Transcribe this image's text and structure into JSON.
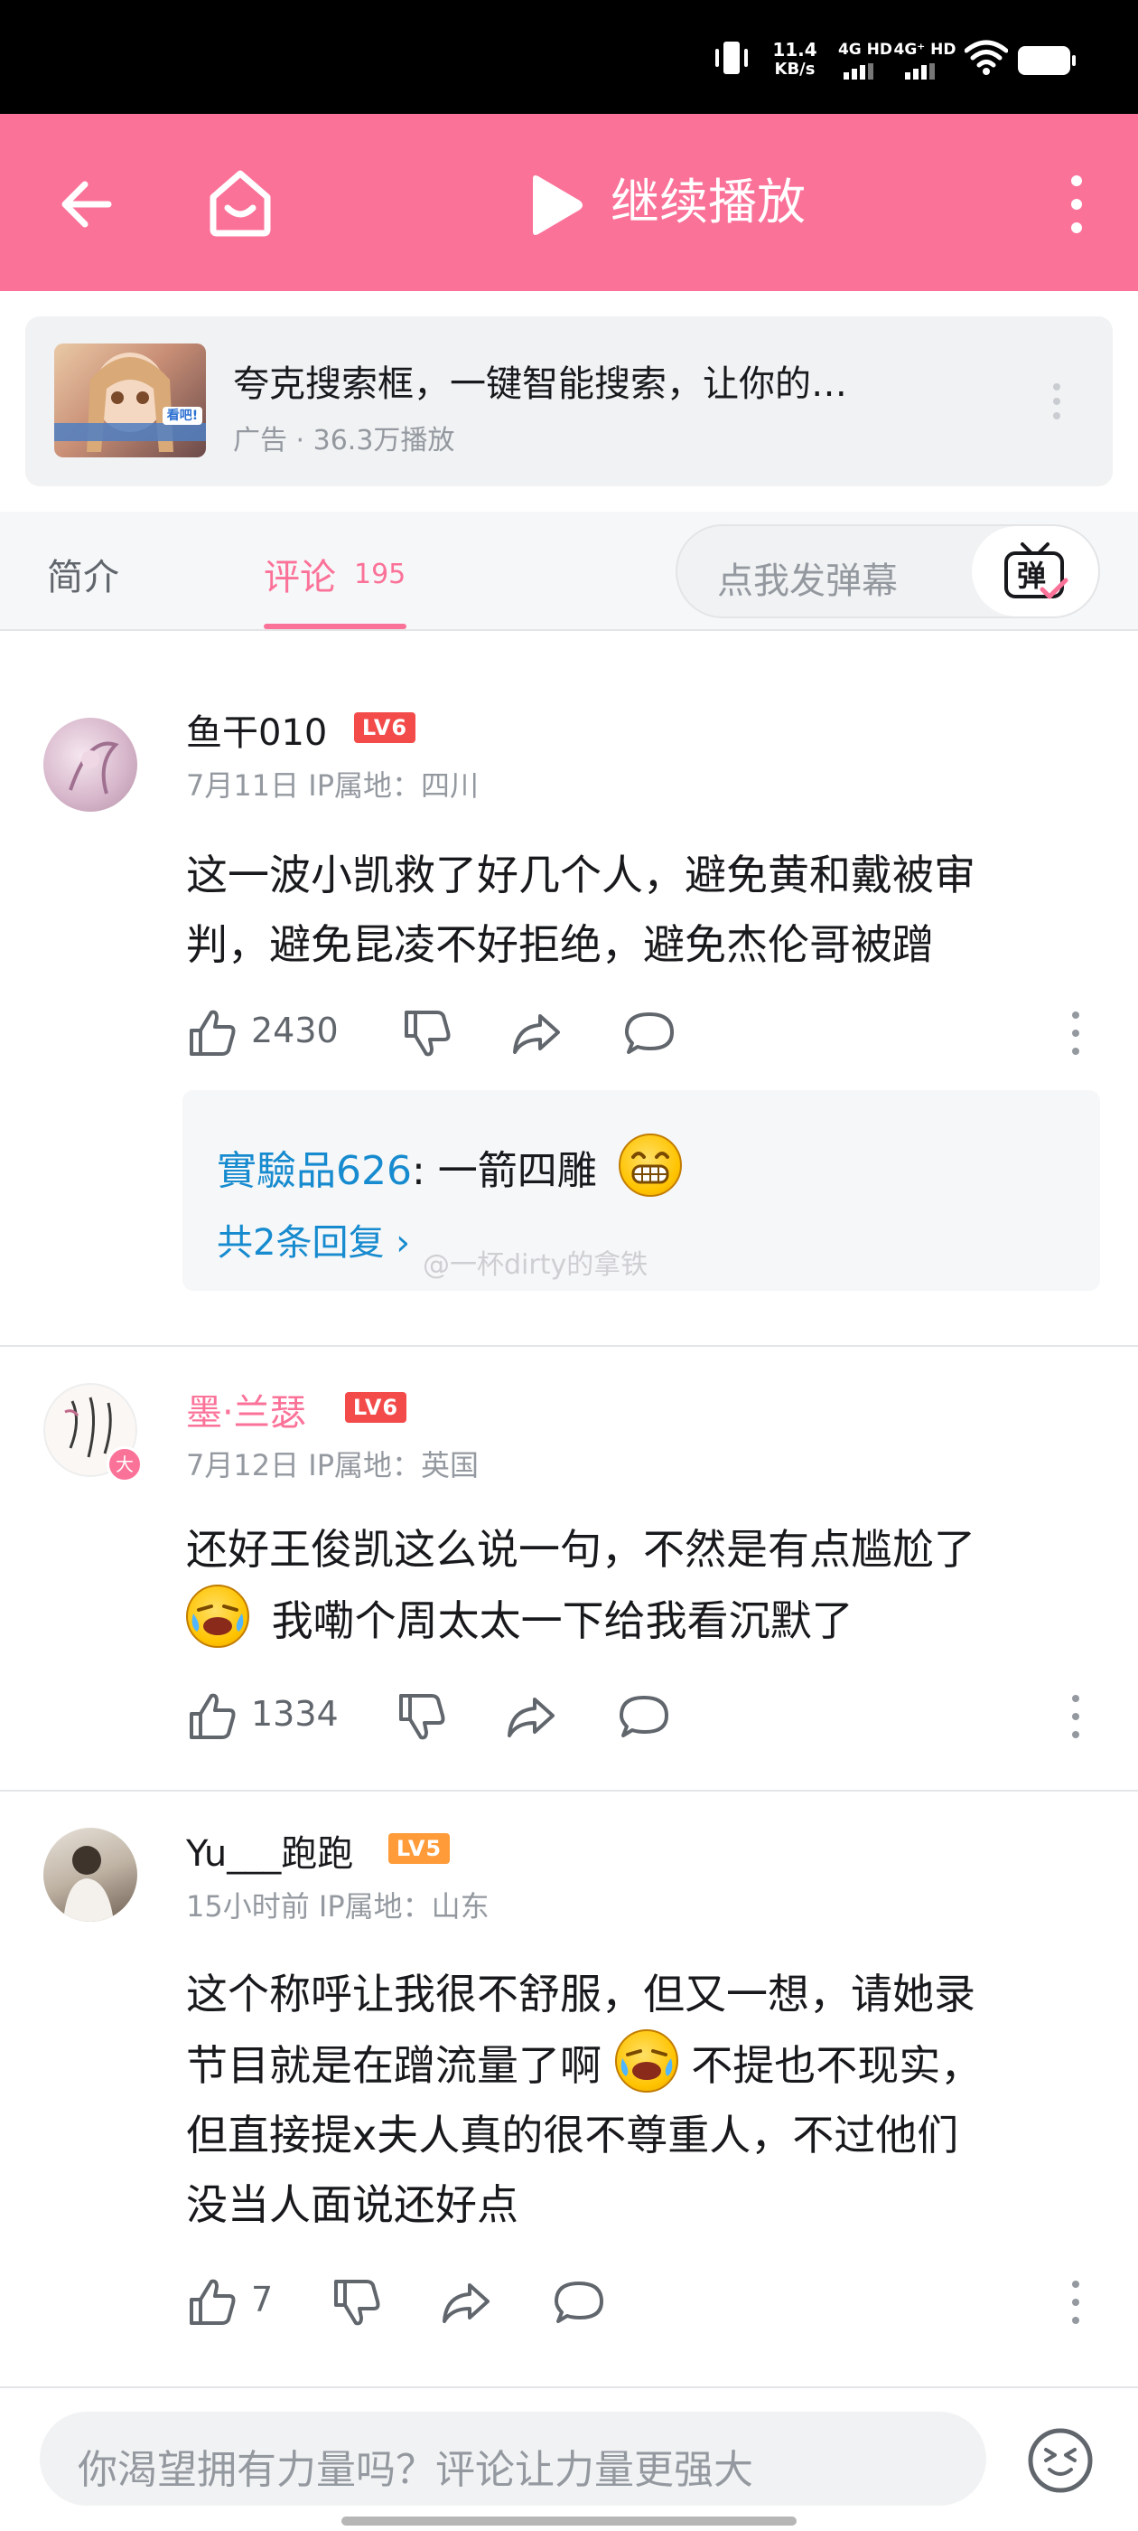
{
  "status_bar": {
    "net_speed_value": "11.4",
    "net_speed_unit": "KB/s",
    "sim1_label": "4G HD",
    "sim2_label": "4G⁺ HD",
    "icons": [
      "vibrate-icon",
      "signal-icon",
      "wifi-icon",
      "battery-icon"
    ]
  },
  "header": {
    "continue_label": "继续播放",
    "accent_color": "#fb7299",
    "icons": [
      "back-arrow-icon",
      "home-icon",
      "play-icon",
      "more-vertical-icon"
    ]
  },
  "ad": {
    "thumb_label": "看吧!",
    "title": "夸克搜索框，一键智能搜索，让你的…",
    "meta": "广告 · 36.3万播放"
  },
  "tabs": {
    "intro": "简介",
    "comments": "评论",
    "comment_count": "195",
    "danmaku_placeholder": "点我发弹幕",
    "danmaku_button": "弹"
  },
  "comments": [
    {
      "username": "鱼干010",
      "level": "LV6",
      "meta": "7月11日 IP属地：四川",
      "lines": [
        "这一波小凯救了好几个人，避免黄和戴被审",
        "判，避免昆凌不好拒绝，避免杰伦哥被蹭"
      ],
      "likes": "2430",
      "reply": {
        "user": "實驗品626",
        "text": ": 一箭四雕",
        "emoji": "grin-emoji",
        "see_all": "共2条回复 ›"
      }
    },
    {
      "username": "墨·兰瑟",
      "level": "LV6",
      "avatar_badge": "大",
      "meta": "7月12日 IP属地：英国",
      "line1": "还好王俊凯这么说一句，不然是有点尴尬了",
      "line2": "我嘞个周太太一下给我看沉默了",
      "likes": "1334"
    },
    {
      "username": "Yu___跑跑",
      "level": "LV5",
      "meta": "15小时前 IP属地：山东",
      "line1": "这个称呼让我很不舒服，但又一想，请她录",
      "line2a": "节目就是在蹭流量了啊",
      "line2b": "不提也不现实，",
      "line3": "但直接提x夫人真的很不尊重人，不过他们",
      "line4": "没当人面说还好点",
      "likes": "7"
    }
  ],
  "watermark": "@一杯dirty的拿铁",
  "bottom": {
    "input_placeholder": "你渴望拥有力量吗？评论让力量更强大",
    "icons": [
      "emoji-face-icon"
    ]
  }
}
